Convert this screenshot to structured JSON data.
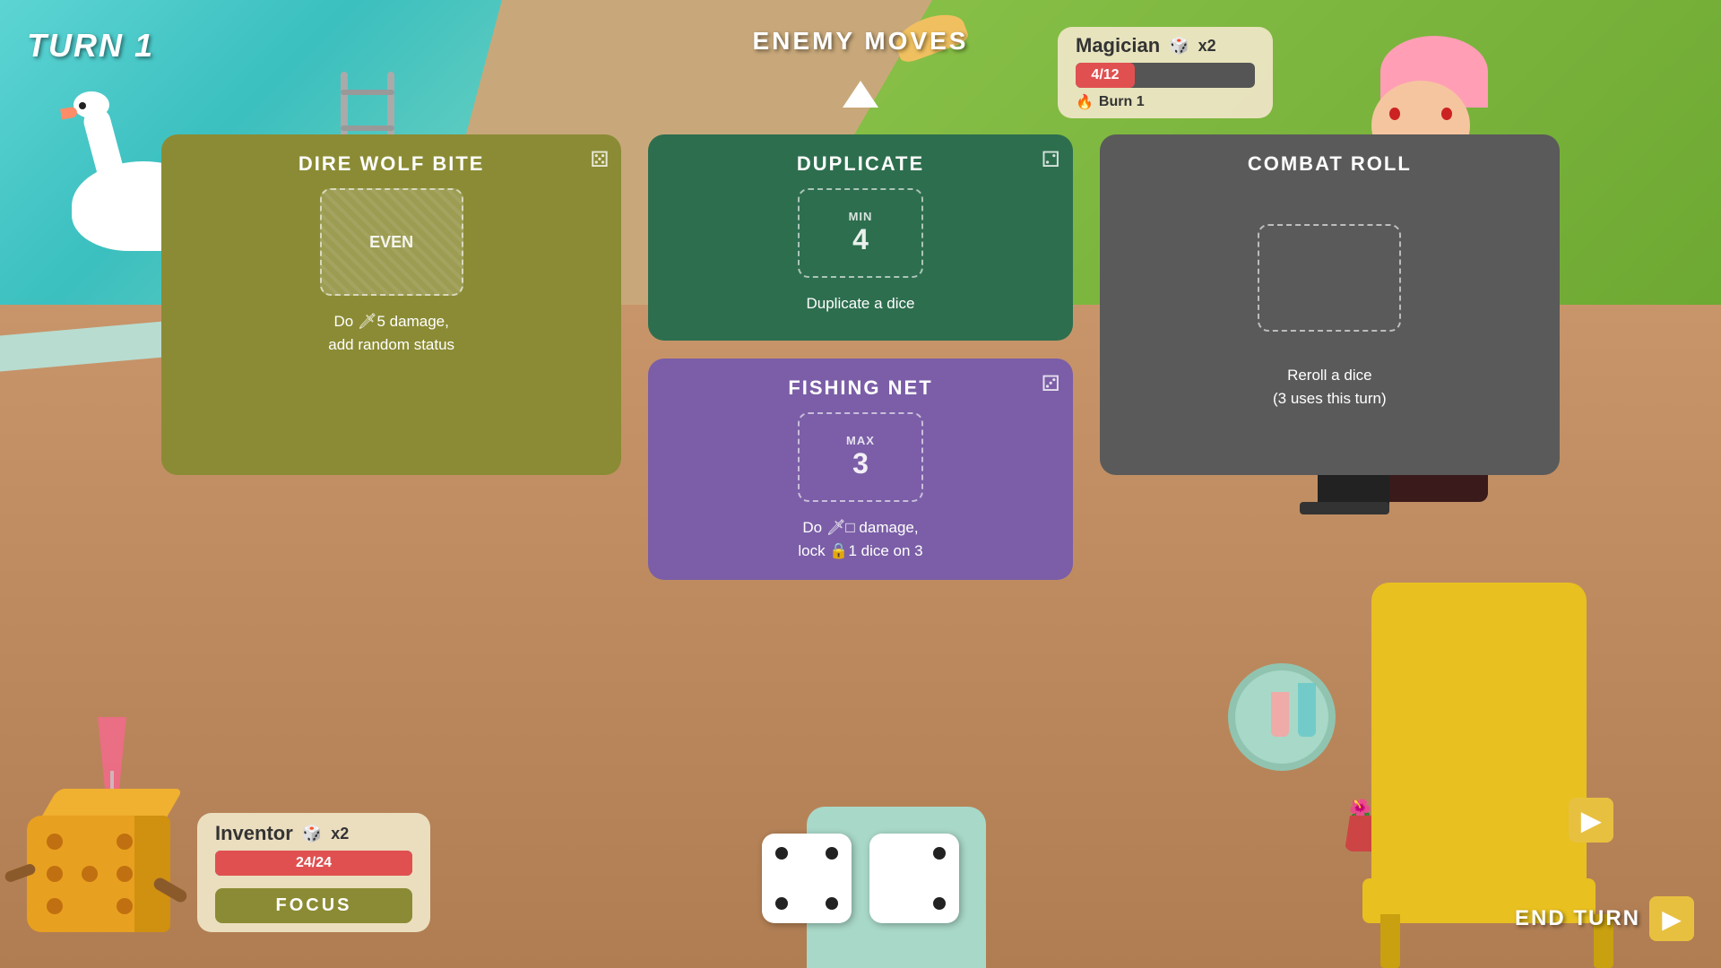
{
  "game": {
    "turn_label": "TURN 1",
    "enemy_moves_label": "ENEMY MOVES",
    "end_turn_label": "END TURN"
  },
  "enemy": {
    "name": "Magician",
    "health_current": 4,
    "health_max": 12,
    "health_display": "4/12",
    "dice_count": "x2",
    "status": "Burn 1",
    "health_pct": 33
  },
  "player": {
    "name": "Inventor",
    "health_current": 24,
    "health_max": 24,
    "health_display": "24/24",
    "dice_count": "x2",
    "focus_label": "FOCUS",
    "health_pct": 100
  },
  "cards": {
    "dire_wolf": {
      "title": "DIRE WOLF BITE",
      "slot_label": "EVEN",
      "description": "Do 🗡5 damage,\nadd random status"
    },
    "duplicate": {
      "title": "DUPLICATE",
      "slot_label": "MIN",
      "slot_value": "4",
      "description": "Duplicate a dice"
    },
    "fishing_net": {
      "title": "FISHING NET",
      "slot_label": "MAX",
      "slot_value": "3",
      "description": "Do 🗡□ damage,\nlock 🔒1 dice on 3"
    },
    "combat_roll": {
      "title": "COMBAT ROLL",
      "description": "Reroll a dice\n(3 uses this turn)"
    }
  },
  "dice": [
    {
      "pips": [
        true,
        false,
        true,
        false,
        false,
        false,
        true,
        false,
        true
      ]
    },
    {
      "pips": [
        false,
        false,
        true,
        false,
        false,
        false,
        false,
        false,
        true
      ]
    }
  ],
  "colors": {
    "dire_wolf": "#8b8b35",
    "duplicate": "#2d6e4e",
    "fishing_net": "#7b5ea7",
    "combat_roll": "#5a5a5a",
    "health_bar": "#e05050",
    "focus_button": "#8b8b35",
    "end_turn_arrow": "#e8c040"
  }
}
